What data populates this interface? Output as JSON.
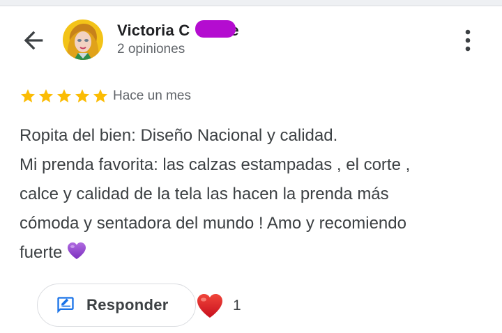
{
  "reviewer": {
    "name": "Victoria C",
    "name_suffix": "e",
    "review_count": "2 opiniones"
  },
  "review": {
    "rating": 5,
    "max_rating": 5,
    "time": "Hace un mes",
    "lines": [
      "Ropita del bien: Diseño Nacional y calidad.",
      "Mi prenda favorita: las calzas estampadas , el corte ,",
      "calce y calidad de la tela las hacen la prenda más",
      "cómoda y sentadora del mundo ! Amo y recomiendo",
      "fuerte"
    ],
    "end_emoji": "purple-heart"
  },
  "actions": {
    "reply_label": "Responder",
    "reaction_emoji": "red-heart",
    "reaction_count": "1"
  },
  "colors": {
    "star": "#fbbc04",
    "accent_blue": "#1a73e8",
    "redaction": "#b40cd0"
  },
  "icons": {
    "back": "arrow-back-icon",
    "more": "more-vert-icon",
    "reply": "rate-review-icon"
  }
}
